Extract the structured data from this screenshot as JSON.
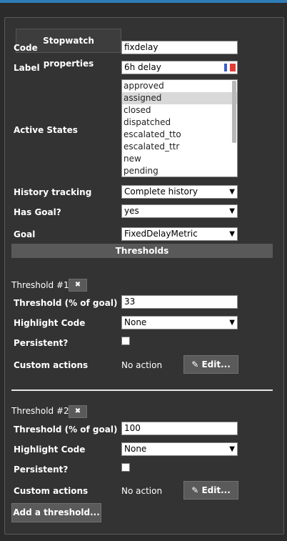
{
  "panel": {
    "title": "Stopwatch properties"
  },
  "fields": {
    "code": {
      "label": "Code",
      "value": "fixdelay"
    },
    "label": {
      "label": "Label",
      "value": "6h delay"
    },
    "active_states": {
      "label": "Active States",
      "options": [
        "approved",
        "assigned",
        "closed",
        "dispatched",
        "escalated_tto",
        "escalated_ttr",
        "new",
        "pending"
      ],
      "selected": "assigned"
    },
    "history_tracking": {
      "label": "History tracking",
      "value": "Complete history"
    },
    "has_goal": {
      "label": "Has Goal?",
      "value": "yes"
    },
    "goal": {
      "label": "Goal",
      "value": "FixedDelayMetric"
    }
  },
  "thresholds_header": "Thresholds",
  "thresholds": [
    {
      "title": "Threshold #1",
      "remove_icon": "✖",
      "percent_label": "Threshold (% of goal)",
      "percent_value": "33",
      "highlight_label": "Highlight Code",
      "highlight_value": "None",
      "persistent_label": "Persistent?",
      "actions_label": "Custom actions",
      "actions_value": "No action",
      "edit_label": "Edit..."
    },
    {
      "title": "Threshold #2",
      "remove_icon": "✖",
      "percent_label": "Threshold (% of goal)",
      "percent_value": "100",
      "highlight_label": "Highlight Code",
      "highlight_value": "None",
      "persistent_label": "Persistent?",
      "actions_label": "Custom actions",
      "actions_value": "No action",
      "edit_label": "Edit..."
    }
  ],
  "add_threshold_label": "Add a threshold...",
  "icons": {
    "dropdown": "chevron-down-icon",
    "edit": "pencil-icon",
    "remove": "close-icon",
    "language": "flag-icon"
  },
  "colors": {
    "accent": "#2f7db8",
    "background": "#2b2b2b",
    "panel": "#333333",
    "header_bar": "#595959"
  }
}
